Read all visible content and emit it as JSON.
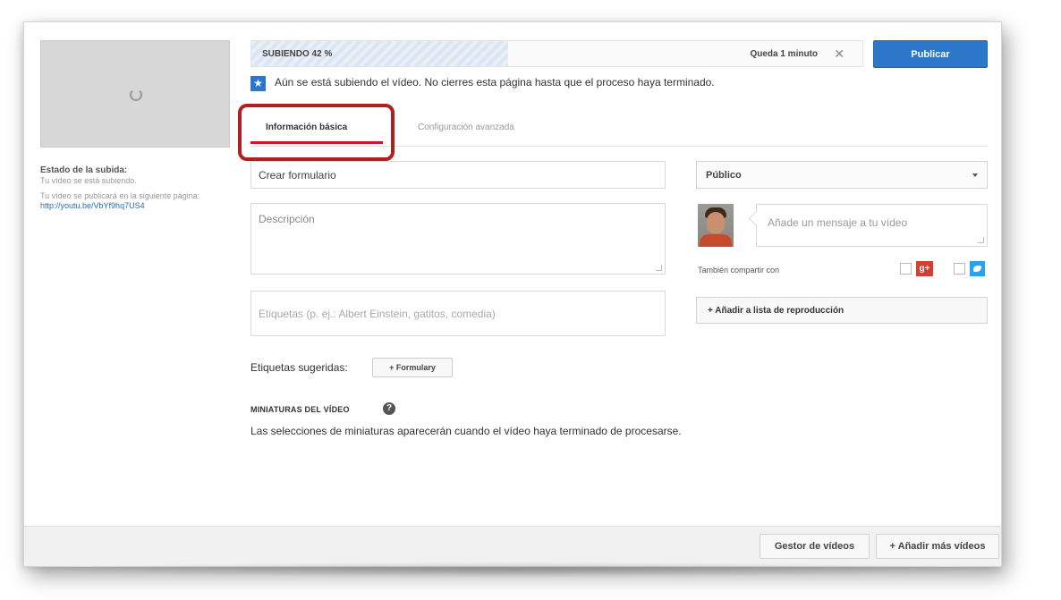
{
  "progress": {
    "label": "SUBIENDO 42 %",
    "percent": 42,
    "remaining": "Queda 1 minuto",
    "close_glyph": "✕"
  },
  "publish_label": "Publicar",
  "notice": {
    "icon": "star-icon",
    "text": "Aún se está subiendo el vídeo. No cierres esta página hasta que el proceso haya terminado."
  },
  "tabs": [
    {
      "label": "Información básica",
      "active": true
    },
    {
      "label": "Configuración avanzada",
      "active": false
    }
  ],
  "highlight_color": "#b11f1f",
  "left_panel": {
    "status_title": "Estado de la subida:",
    "status_text": "Tu vídeo se está subiendo.",
    "publish_text": "Tu vídeo se publicará en la siguiente página:",
    "link": "http://youtu.be/VbYf9hq7US4"
  },
  "form": {
    "title_value": "Crear formulario",
    "description_placeholder": "Descripción",
    "tags_placeholder": "Etiquetas (p. ej.: Albert Einstein, gatitos, comedia)",
    "suggested_label": "Etiquetas sugeridas:",
    "suggested_chip": "+ Formulary"
  },
  "thumbnails": {
    "title": "MINIATURAS DEL VÍDEO",
    "help_glyph": "?",
    "text": "Las selecciones de miniaturas aparecerán cuando el vídeo haya terminado de procesarse."
  },
  "sidebar": {
    "privacy_value": "Público",
    "message_placeholder": "Añade un mensaje a tu vídeo",
    "share_label": "También compartir con",
    "gplus_glyph": "g+",
    "add_playlist": "+ Añadir a lista de reproducción"
  },
  "footer": {
    "manager_label": "Gestor de vídeos",
    "add_more_label": "+ Añadir más vídeos"
  },
  "colors": {
    "accent_blue": "#2c77c9",
    "tab_red": "#cc181e"
  }
}
